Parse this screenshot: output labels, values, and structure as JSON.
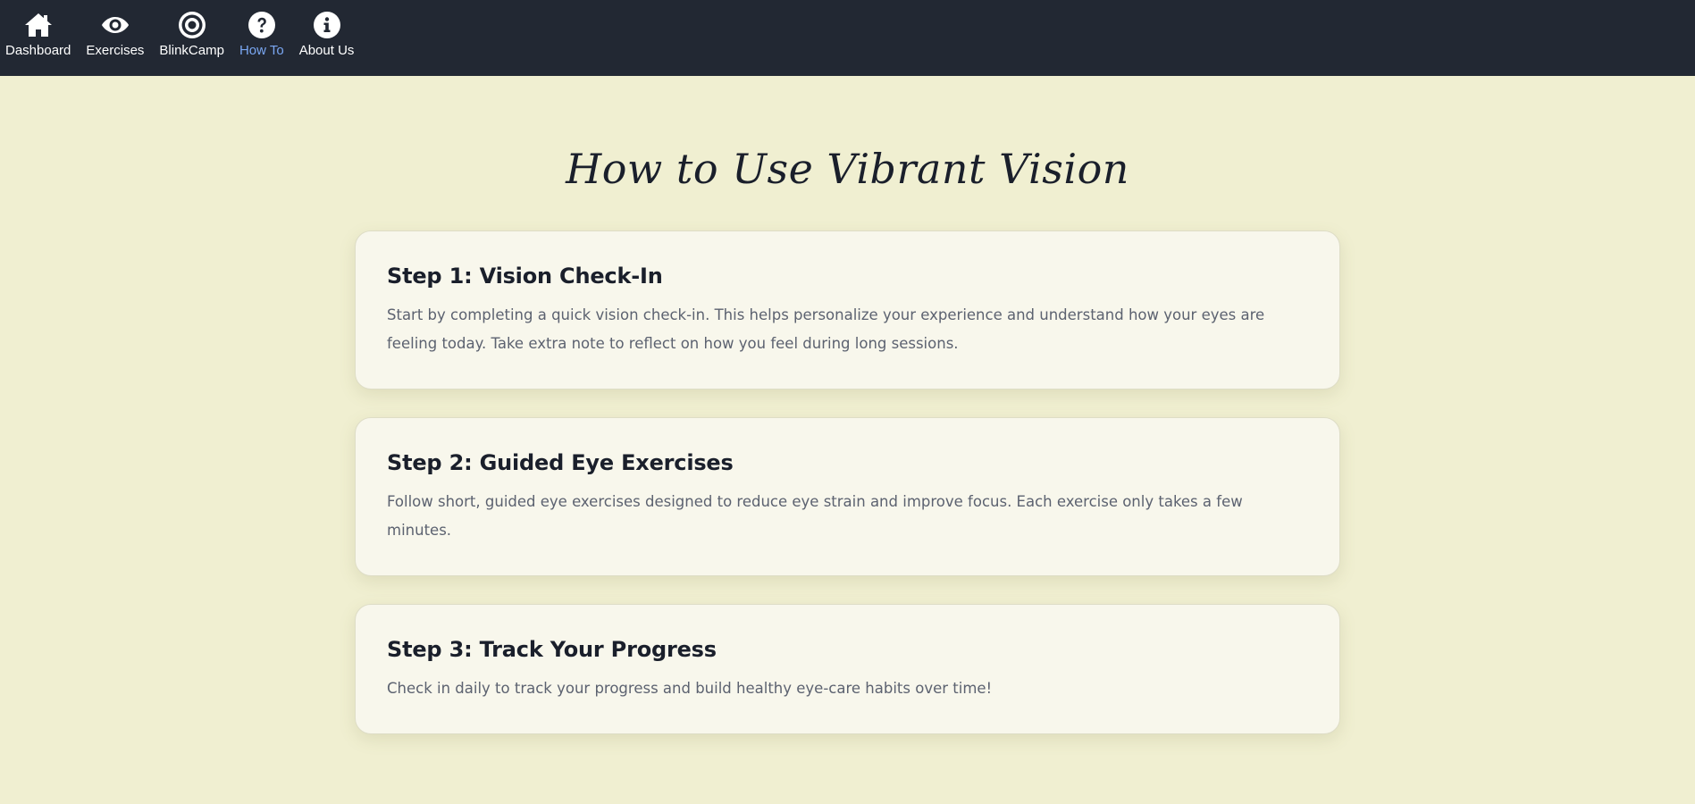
{
  "nav": {
    "items": [
      {
        "label": "Dashboard",
        "icon": "home-icon",
        "active": false
      },
      {
        "label": "Exercises",
        "icon": "eye-icon",
        "active": false
      },
      {
        "label": "BlinkCamp",
        "icon": "target-icon",
        "active": false
      },
      {
        "label": "How To",
        "icon": "question-circle-icon",
        "active": true
      },
      {
        "label": "About Us",
        "icon": "info-circle-icon",
        "active": false
      }
    ]
  },
  "page": {
    "title": "How to Use Vibrant Vision"
  },
  "steps": [
    {
      "title": "Step 1: Vision Check-In",
      "text": "Start by completing a quick vision check-in. This helps personalize your experience and understand how your eyes are feeling today. Take extra note to reflect on how you feel during long sessions."
    },
    {
      "title": "Step 2: Guided Eye Exercises",
      "text": "Follow short, guided eye exercises designed to reduce eye strain and improve focus. Each exercise only takes a few minutes."
    },
    {
      "title": "Step 3: Track Your Progress",
      "text": "Check in daily to track your progress and build healthy eye-care habits over time!"
    }
  ],
  "colors": {
    "navbar_bg": "#222833",
    "active_nav": "#7aa7f2",
    "page_bg": "#f0efd1",
    "card_bg": "#f8f7ec"
  }
}
